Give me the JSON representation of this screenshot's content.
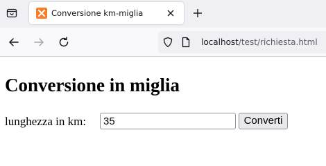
{
  "browser": {
    "tab": {
      "title": "Conversione km-miglia",
      "favicon_color": "#fb7a24"
    },
    "address_bar": {
      "host": "localhost",
      "path": "/test/richiesta.html"
    },
    "icons": {
      "tab_list": "tab-list-icon",
      "close": "close-icon",
      "new_tab": "plus-icon",
      "back": "back-arrow-icon",
      "forward": "forward-arrow-icon",
      "reload": "reload-icon",
      "tracking_protection": "shield-icon",
      "page_info": "page-icon"
    }
  },
  "page": {
    "title": "Conversione in miglia",
    "form": {
      "label": "lunghezza in km:",
      "input_value": "35",
      "submit_label": "Converti"
    }
  }
}
